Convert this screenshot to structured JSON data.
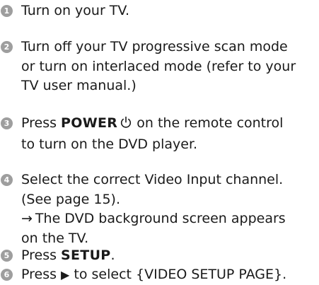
{
  "steps": [
    {
      "number": "1",
      "line1": "Turn on your TV."
    },
    {
      "number": "2",
      "line1": "Turn off your TV progressive scan mode",
      "line2": "or turn on interlaced mode (refer to your",
      "line3": "TV user manual.)"
    },
    {
      "number": "3",
      "prefix": "Press ",
      "button": "POWER",
      "icon": "power-icon",
      "suffix": " on the remote control",
      "line2": "to turn on the DVD player."
    },
    {
      "number": "4",
      "line1": "Select the correct Video Input channel.",
      "line2": "(See page 15).",
      "arrow": "→",
      "result": "The DVD background screen appears",
      "line4": "on the TV."
    },
    {
      "number": "5",
      "prefix": "Press ",
      "button": "SETUP",
      "suffix": "."
    },
    {
      "number": "6",
      "prefix": "Press ",
      "symbol": "▶",
      "suffix": " to select {VIDEO SETUP PAGE}."
    }
  ]
}
